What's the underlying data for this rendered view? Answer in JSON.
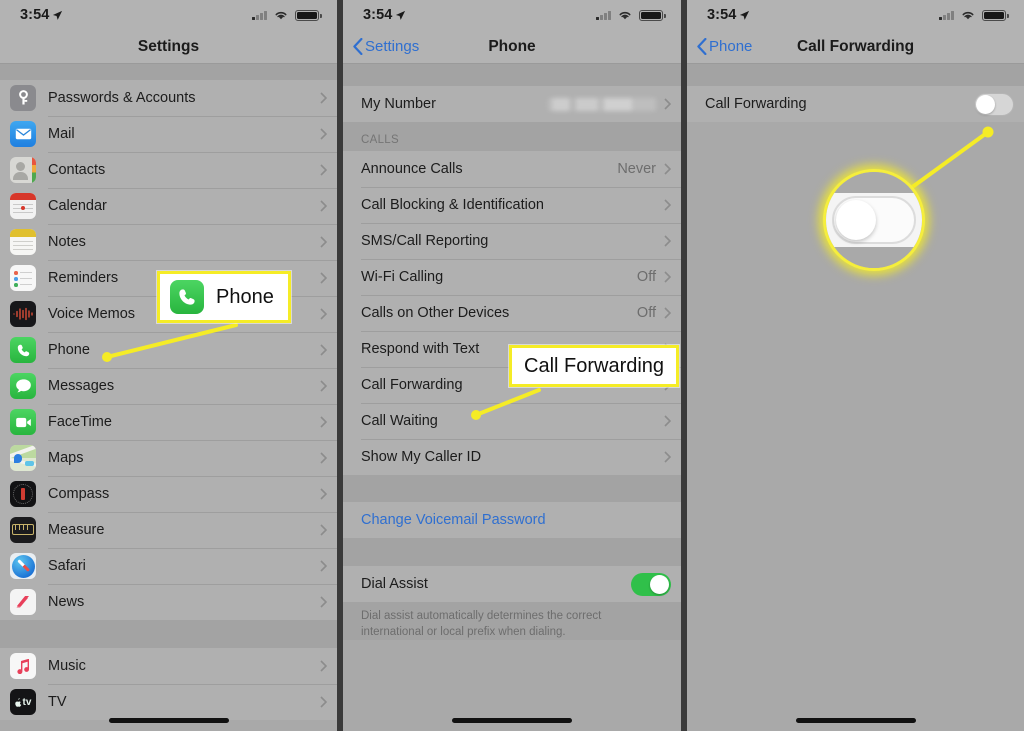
{
  "status_bar": {
    "time": "3:54",
    "location_icon": "location-arrow-icon",
    "signal_icon": "cellular-signal-icon",
    "wifi_icon": "wifi-icon",
    "battery_icon": "battery-full-icon"
  },
  "panel1": {
    "title": "Settings",
    "groups": [
      {
        "items": [
          {
            "label": "Passwords & Accounts",
            "icon": "key-icon"
          },
          {
            "label": "Mail",
            "icon": "mail-icon"
          },
          {
            "label": "Contacts",
            "icon": "contacts-icon"
          },
          {
            "label": "Calendar",
            "icon": "calendar-icon"
          },
          {
            "label": "Notes",
            "icon": "notes-icon"
          },
          {
            "label": "Reminders",
            "icon": "reminders-icon"
          },
          {
            "label": "Voice Memos",
            "icon": "voice-memos-icon"
          },
          {
            "label": "Phone",
            "icon": "phone-icon"
          },
          {
            "label": "Messages",
            "icon": "messages-icon"
          },
          {
            "label": "FaceTime",
            "icon": "facetime-icon"
          },
          {
            "label": "Maps",
            "icon": "maps-icon"
          },
          {
            "label": "Compass",
            "icon": "compass-icon"
          },
          {
            "label": "Measure",
            "icon": "measure-icon"
          },
          {
            "label": "Safari",
            "icon": "safari-icon"
          },
          {
            "label": "News",
            "icon": "news-icon"
          }
        ]
      },
      {
        "items": [
          {
            "label": "Music",
            "icon": "music-icon"
          },
          {
            "label": "TV",
            "icon": "tv-icon"
          }
        ]
      }
    ]
  },
  "panel2": {
    "back_label": "Settings",
    "title": "Phone",
    "my_number_label": "My Number",
    "my_number_value": "",
    "calls_header": "CALLS",
    "calls_items": [
      {
        "label": "Announce Calls",
        "value": "Never"
      },
      {
        "label": "Call Blocking & Identification",
        "value": ""
      },
      {
        "label": "SMS/Call Reporting",
        "value": ""
      },
      {
        "label": "Wi-Fi Calling",
        "value": "Off"
      },
      {
        "label": "Calls on Other Devices",
        "value": "Off"
      },
      {
        "label": "Respond with Text",
        "value": ""
      },
      {
        "label": "Call Forwarding",
        "value": ""
      },
      {
        "label": "Call Waiting",
        "value": ""
      },
      {
        "label": "Show My Caller ID",
        "value": ""
      }
    ],
    "change_voicemail": "Change Voicemail Password",
    "dial_assist_label": "Dial Assist",
    "dial_assist_state": "on",
    "dial_assist_footnote": "Dial assist automatically determines the correct international or local prefix when dialing."
  },
  "panel3": {
    "back_label": "Phone",
    "title": "Call Forwarding",
    "row_label": "Call Forwarding",
    "toggle_state": "off"
  },
  "annotations": {
    "callout_phone": {
      "text": "Phone",
      "icon": "phone-icon"
    },
    "callout_call_forwarding": {
      "text": "Call Forwarding"
    },
    "highlight_color": "#f5ec26"
  }
}
